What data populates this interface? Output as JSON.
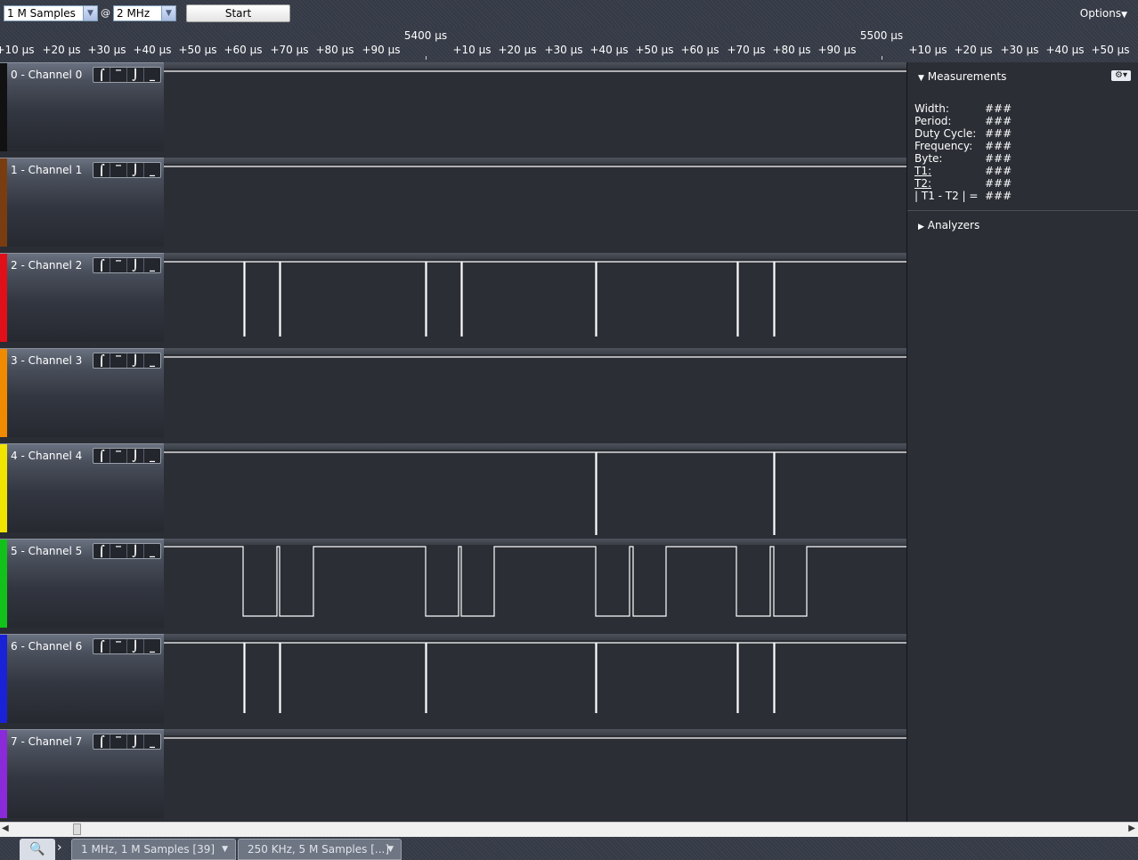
{
  "toolbar": {
    "samples_value": "1 M Samples",
    "at_symbol": "@",
    "rate_value": "2 MHz",
    "start_label": "Start",
    "options_label": "Options"
  },
  "ruler": {
    "major_labels": [
      "5400 µs",
      "5500 µs"
    ],
    "tick_labels": [
      "+10 µs",
      "+20 µs",
      "+30 µs",
      "+40 µs",
      "+50 µs",
      "+60 µs",
      "+70 µs",
      "+80 µs",
      "+90 µs",
      "+10 µs",
      "+20 µs",
      "+30 µs",
      "+40 µs",
      "+50 µs",
      "+60 µs",
      "+70 µs",
      "+80 µs",
      "+90 µs",
      "+10 µs",
      "+20 µs",
      "+30 µs",
      "+40 µs",
      "+50 µs"
    ]
  },
  "trigger_glyphs": [
    "⌠",
    "‾",
    "⌡",
    "_"
  ],
  "channels": [
    {
      "name": "0 - Channel 0",
      "color": "#111111",
      "signal": "high"
    },
    {
      "name": "1 - Channel 1",
      "color": "#7a3d12",
      "signal": "high"
    },
    {
      "name": "2 - Channel 2",
      "color": "#e0101a",
      "signal": "pulses"
    },
    {
      "name": "3 - Channel 3",
      "color": "#f08a00",
      "signal": "high"
    },
    {
      "name": "4 - Channel 4",
      "color": "#f0e400",
      "signal": "pulses"
    },
    {
      "name": "5 - Channel 5",
      "color": "#12c21a",
      "signal": "data"
    },
    {
      "name": "6 - Channel 6",
      "color": "#1a22d8",
      "signal": "pulses"
    },
    {
      "name": "7 - Channel 7",
      "color": "#8a2ad8",
      "signal": "high"
    }
  ],
  "measurements": {
    "header": "Measurements",
    "rows": [
      {
        "label": "Width:",
        "value": "###"
      },
      {
        "label": "Period:",
        "value": "###"
      },
      {
        "label": "Duty Cycle:",
        "value": "###"
      },
      {
        "label": "Frequency:",
        "value": "###"
      },
      {
        "label": "Byte:",
        "value": "###"
      },
      {
        "label": "T1:",
        "value": "###"
      },
      {
        "label": "T2:",
        "value": "###"
      },
      {
        "label": "| T1 - T2 | =",
        "value": "###"
      }
    ]
  },
  "analyzers": {
    "header": "Analyzers"
  },
  "tabs": [
    {
      "label": "1 MHz, 1 M Samples [39]"
    },
    {
      "label": "250 KHz, 5 M Samples [...]"
    }
  ]
}
